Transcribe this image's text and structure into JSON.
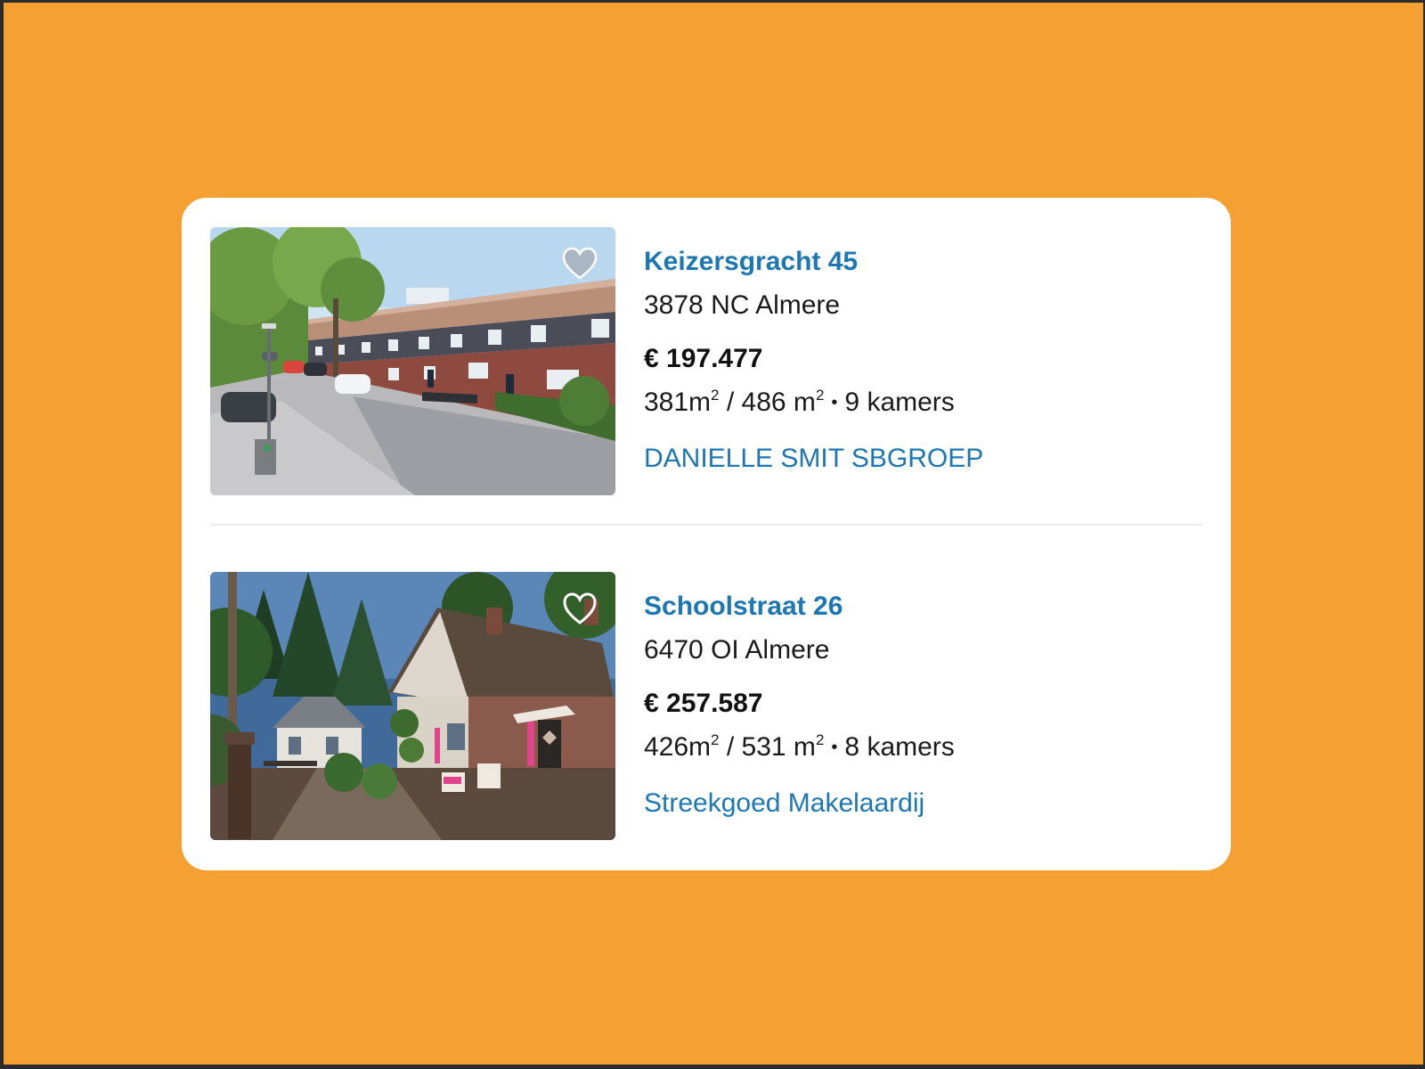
{
  "listings": [
    {
      "title": "Keizersgracht 45",
      "address": "3878 NC Almere",
      "price": "€ 197.477",
      "living_area": "381m",
      "plot_area": "486 m",
      "area_sup": "2",
      "area_separator": "/",
      "bullet": "•",
      "rooms": "9 kamers",
      "agent": "DANIELLE SMIT SBGROEP",
      "favorite_icon": "heart-filled-icon",
      "favorited": false
    },
    {
      "title": "Schoolstraat 26",
      "address": "6470 OI Almere",
      "price": "€ 257.587",
      "living_area": "426m",
      "plot_area": "531 m",
      "area_sup": "2",
      "area_separator": "/",
      "bullet": "•",
      "rooms": "8 kamers",
      "agent": "Streekgoed Makelaardij",
      "favorite_icon": "heart-outline-icon",
      "favorited": false
    }
  ],
  "colors": {
    "background": "#f5a033",
    "card": "#ffffff",
    "link": "#1c77b3",
    "text": "#1a1a1a"
  }
}
